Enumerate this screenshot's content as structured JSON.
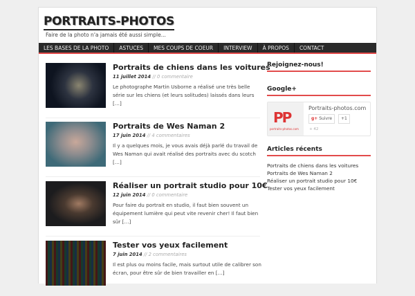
{
  "site": {
    "title": "PORTRAITS-PHOTOS",
    "tagline": "Faire de la photo n'a jamais été aussi simple..."
  },
  "nav": [
    "LES BASES DE LA PHOTO",
    "ASTUCES",
    "MES COUPS DE COEUR",
    "INTERVIEW",
    "À PROPOS",
    "CONTACT"
  ],
  "posts": [
    {
      "title": "Portraits de chiens dans les voitures",
      "date": "11 juillet 2014",
      "comments": "// 0 commentaire",
      "excerpt": "Le photographe Martin Usborne a réalisé une très belle série sur les chiens (et leurs solitudes) laissés dans leurs […]"
    },
    {
      "title": "Portraits de Wes Naman 2",
      "date": "17 juin 2014",
      "comments": "// 4 commentaires",
      "excerpt": "Il y a quelques mois, je vous avais déjà parlé du travail de Wes Naman qui avait réalisé des portraits avec du scotch […]"
    },
    {
      "title": "Réaliser un portrait studio pour 10€",
      "date": "12 juin 2014",
      "comments": "// 0 commentaire",
      "excerpt": "Pour faire du portrait en studio, il faut bien souvent un équipement lumière qui peut vite revenir cher! Il faut bien sûr […]"
    },
    {
      "title": "Tester vos yeux facilement",
      "date": "7 juin 2014",
      "comments": "// 2 commentaires",
      "excerpt": "Il est plus ou moins facile, mais surtout utile de calibrer son écran, pour être sûr de bien travailler en […]"
    }
  ],
  "sidebar": {
    "join": "Rejoignez-nous!",
    "gplus": {
      "title": "Google+",
      "name": "Portraits-photos.com",
      "follow": "Suivre",
      "plus": "+1",
      "count": "+ 42",
      "logo_text": "portraits-photos.com",
      "logo_letters": "PP"
    },
    "recent_title": "Articles récents",
    "recent": [
      "Portraits de chiens dans les voitures",
      "Portraits de Wes Naman 2",
      "Réaliser un portrait studio pour 10€",
      "Tester vos yeux facilement"
    ]
  }
}
